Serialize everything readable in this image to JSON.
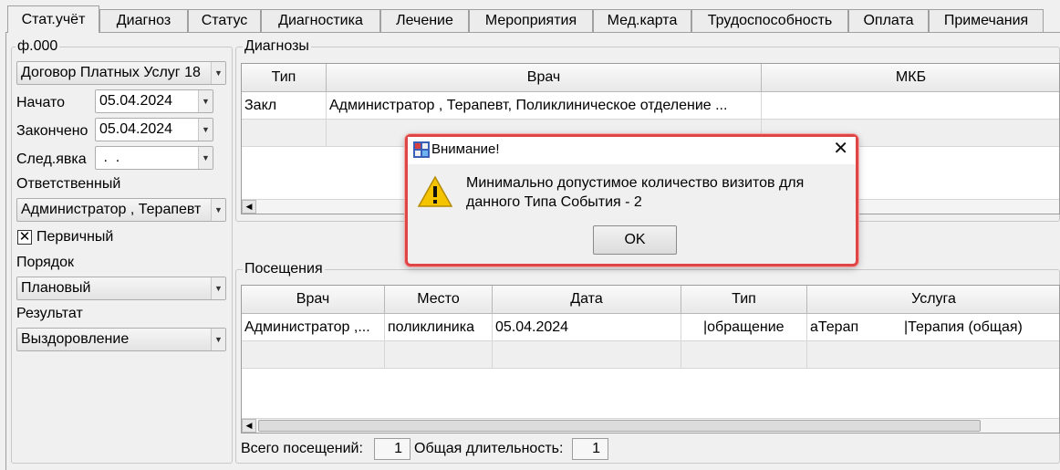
{
  "tabs": [
    "Стат.учёт",
    "Диагноз",
    "Статус",
    "Диагностика",
    "Лечение",
    "Мероприятия",
    "Мед.карта",
    "Трудоспособность",
    "Оплата",
    "Примечания"
  ],
  "left": {
    "group_title": "ф.000",
    "contract": "Договор Платных Услуг 18",
    "start_label": "Начато",
    "start_value": "05.04.2024",
    "end_label": "Закончено",
    "end_value": "05.04.2024",
    "next_label": "След.явка",
    "next_value": " .  .",
    "responsible_label": "Ответственный",
    "responsible_value": "Администратор , Терапевт",
    "primary_label": "Первичный",
    "primary_checked": "✕",
    "order_label": "Порядок",
    "order_value": "Плановый",
    "result_label": "Результат",
    "result_value": "Выздоровление"
  },
  "diagnoses": {
    "title": "Диагнозы",
    "columns": [
      "Тип",
      "Врач",
      "МКБ"
    ],
    "rows": [
      [
        "Закл",
        "Администратор , Терапевт, Поликлиническое отделение ...",
        ""
      ]
    ]
  },
  "visits": {
    "title": "Посещения",
    "columns": [
      "Врач",
      "Место",
      "Дата",
      "Тип",
      "Услуга"
    ],
    "rows": [
      [
        "Администратор ,...",
        "поликлиника",
        "05.04.2024",
        "|обращение",
        "аТерап",
        "|Терапия (общая)"
      ]
    ],
    "total_label": "Всего посещений:",
    "total_value": "1",
    "duration_label": "Общая длительность:",
    "duration_value": "1"
  },
  "dialog": {
    "title": "Внимание!",
    "message_line1": "Минимально допустимое количество визитов для",
    "message_line2": "данного Типа События - 2",
    "ok_label": "OK",
    "icon": "warning-icon",
    "close_icon": "close-icon"
  }
}
